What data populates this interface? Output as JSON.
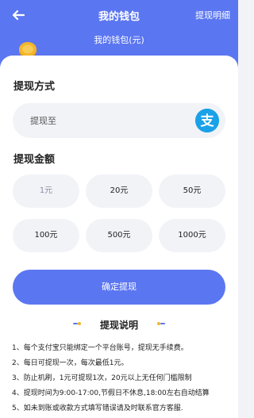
{
  "header": {
    "title": "我的钱包",
    "records_link": "提现明细",
    "balance_label": "我的钱包(元)",
    "back_icon": "arrow-left-icon",
    "coin_icon": "gold-coin-icon"
  },
  "withdraw_method": {
    "section_title": "提现方式",
    "placeholder_label": "提现至",
    "icon": "alipay-icon",
    "icon_glyph": "支"
  },
  "withdraw_amount": {
    "section_title": "提现金额",
    "options": [
      "1元",
      "20元",
      "50元",
      "100元",
      "500元",
      "1000元"
    ],
    "selected_index": 0
  },
  "confirm_button": "确定提现",
  "notes": {
    "title": "提现说明",
    "items": [
      "1、每个支付宝只能绑定一个平台账号，提现无手续费。",
      "2、每日可提现一次，每次最低1元。",
      "3、防止机刷，1元可提现1次，20元以上无任何门槛限制",
      "4、提现时间为9:00-17:00,节假日不休息,18:00左右自动结算",
      "5、如未到账或收款方式填写错误请及时联系官方客服."
    ]
  },
  "colors": {
    "primary": "#5b76f1",
    "alipay": "#1aa1e8",
    "field_bg": "#f1f3f7",
    "coin": "#f3b52a"
  }
}
